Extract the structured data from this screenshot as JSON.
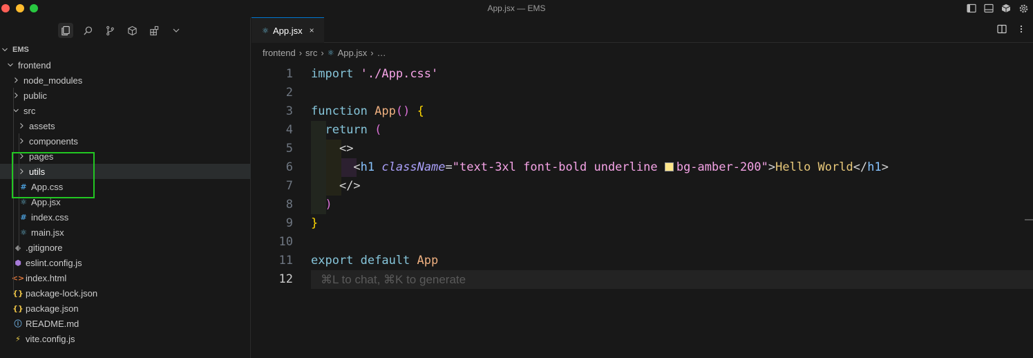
{
  "window": {
    "title": "App.jsx — EMS"
  },
  "titlebar_icons": [
    "toggle-sidebar-icon",
    "toggle-panel-icon",
    "cube-icon",
    "gear-icon"
  ],
  "activity_icons": [
    "files-icon",
    "search-icon",
    "source-control-icon",
    "cube-icon",
    "extensions-icon",
    "chevron-down-icon"
  ],
  "explorer": {
    "root": "EMS",
    "items": [
      {
        "label": "frontend",
        "depth": 1,
        "type": "folder",
        "open": true
      },
      {
        "label": "node_modules",
        "depth": 2,
        "type": "folder",
        "open": false
      },
      {
        "label": "public",
        "depth": 2,
        "type": "folder",
        "open": false
      },
      {
        "label": "src",
        "depth": 2,
        "type": "folder",
        "open": true
      },
      {
        "label": "assets",
        "depth": 3,
        "type": "folder",
        "open": false
      },
      {
        "label": "components",
        "depth": 3,
        "type": "folder",
        "open": false
      },
      {
        "label": "pages",
        "depth": 3,
        "type": "folder",
        "open": false
      },
      {
        "label": "utils",
        "depth": 3,
        "type": "folder",
        "open": false,
        "selected": true
      },
      {
        "label": "App.css",
        "depth": 3,
        "type": "css"
      },
      {
        "label": "App.jsx",
        "depth": 3,
        "type": "react"
      },
      {
        "label": "index.css",
        "depth": 3,
        "type": "css"
      },
      {
        "label": "main.jsx",
        "depth": 3,
        "type": "react"
      },
      {
        "label": ".gitignore",
        "depth": 2,
        "type": "git"
      },
      {
        "label": "eslint.config.js",
        "depth": 2,
        "type": "eslint"
      },
      {
        "label": "index.html",
        "depth": 2,
        "type": "html"
      },
      {
        "label": "package-lock.json",
        "depth": 2,
        "type": "json"
      },
      {
        "label": "package.json",
        "depth": 2,
        "type": "json"
      },
      {
        "label": "README.md",
        "depth": 2,
        "type": "info"
      },
      {
        "label": "vite.config.js",
        "depth": 2,
        "type": "vite"
      }
    ]
  },
  "editor": {
    "tab": {
      "label": "App.jsx",
      "close": "×"
    },
    "breadcrumb": [
      "frontend",
      "src",
      "App.jsx",
      "…"
    ],
    "hint": "⌘L to chat, ⌘K to generate",
    "lines": [
      "1",
      "2",
      "3",
      "4",
      "5",
      "6",
      "7",
      "8",
      "9",
      "10",
      "11",
      "12"
    ],
    "code": {
      "l1_kw": "import",
      "l1_str": "'./App.css'",
      "l3_kw": "function",
      "l3_fn": "App",
      "l3_parens": "()",
      "l3_brace": "{",
      "l4_kw": "return",
      "l4_paren": "(",
      "l5_frag": "<>",
      "l6_open": "<",
      "l6_tag": "h1",
      "l6_attr": "className",
      "l6_eq": "=",
      "l6_str1": "\"text-3xl font-bold underline ",
      "l6_str2": "bg-amber-200\"",
      "l6_gt": ">",
      "l6_text": "Hello World",
      "l6_close": "</",
      "l6_tag2": "h1",
      "l6_gt2": ">",
      "l7_frag": "</>",
      "l8_paren": ")",
      "l9_brace": "}",
      "l11_kw": "export default",
      "l11_fn": "App"
    },
    "swatch_color": "#fde68a"
  }
}
